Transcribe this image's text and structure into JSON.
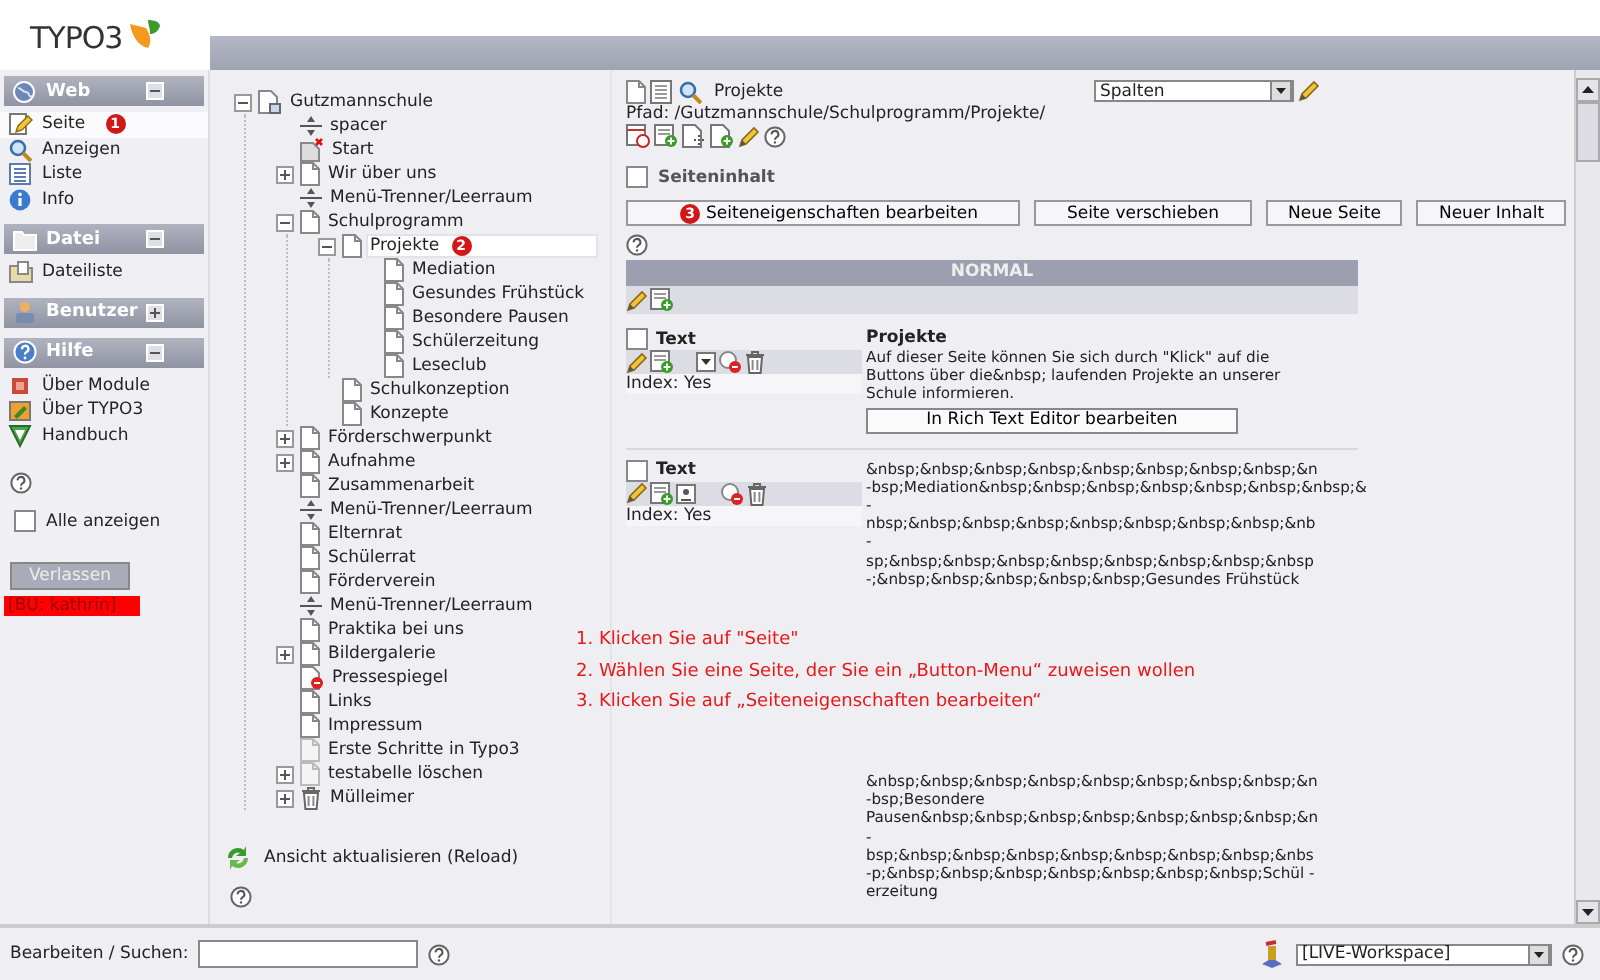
{
  "logo": "TYPO3",
  "modules": [
    {
      "title": "Web",
      "expanded": true,
      "items": [
        {
          "label": "Seite",
          "selected": true,
          "badge": "1"
        },
        {
          "label": "Anzeigen",
          "selected": false
        },
        {
          "label": "Liste",
          "selected": false
        },
        {
          "label": "Info",
          "selected": false
        }
      ]
    },
    {
      "title": "Datei",
      "expanded": true,
      "items": [
        {
          "label": "Dateiliste",
          "selected": false
        }
      ]
    },
    {
      "title": "Benutzer",
      "expanded": false
    },
    {
      "title": "Hilfe",
      "expanded": true,
      "items": [
        {
          "label": "Über Module",
          "selected": false
        },
        {
          "label": "Über TYPO3",
          "selected": false
        },
        {
          "label": "Handbuch",
          "selected": false
        }
      ]
    }
  ],
  "show_all": {
    "label": "Alle anzeigen",
    "checked": false
  },
  "logout": "Verlassen",
  "user": "[BU: kathrin]",
  "tree": [
    {
      "label": "Gutzmannschule",
      "kind": "root",
      "selected": false,
      "expanded": true,
      "children": [
        {
          "label": "spacer",
          "kind": "separator",
          "selected": false
        },
        {
          "label": "Start",
          "kind": "hidden",
          "selected": false
        },
        {
          "label": "Wir über uns",
          "kind": "page",
          "selected": false,
          "expanded": false
        },
        {
          "label": "Menü-Trenner/Leerraum",
          "kind": "separator",
          "selected": false
        },
        {
          "label": "Schulprogramm",
          "kind": "page",
          "selected": false,
          "expanded": true,
          "children": [
            {
              "label": "Projekte",
              "kind": "page",
              "selected": true,
              "badge": "2",
              "expanded": true,
              "children": [
                {
                  "label": "Mediation",
                  "kind": "page",
                  "selected": false
                },
                {
                  "label": "Gesundes Frühstück",
                  "kind": "page",
                  "selected": false
                },
                {
                  "label": "Besondere Pausen",
                  "kind": "page",
                  "selected": false
                },
                {
                  "label": "Schülerzeitung",
                  "kind": "page",
                  "selected": false
                },
                {
                  "label": "Leseclub",
                  "kind": "page",
                  "selected": false
                }
              ]
            },
            {
              "label": "Schulkonzeption",
              "kind": "page",
              "selected": false
            },
            {
              "label": "Konzepte",
              "kind": "page",
              "selected": false
            }
          ]
        },
        {
          "label": "Förderschwerpunkt",
          "kind": "page",
          "selected": false,
          "expanded": false
        },
        {
          "label": "Aufnahme",
          "kind": "page",
          "selected": false,
          "expanded": false
        },
        {
          "label": "Zusammenarbeit",
          "kind": "page",
          "selected": false
        },
        {
          "label": "Menü-Trenner/Leerraum",
          "kind": "separator",
          "selected": false
        },
        {
          "label": "Elternrat",
          "kind": "page",
          "selected": false
        },
        {
          "label": "Schülerrat",
          "kind": "page",
          "selected": false
        },
        {
          "label": "Förderverein",
          "kind": "page",
          "selected": false
        },
        {
          "label": "Menü-Trenner/Leerraum",
          "kind": "separator",
          "selected": false
        },
        {
          "label": "Praktika bei uns",
          "kind": "page",
          "selected": false
        },
        {
          "label": "Bildergalerie",
          "kind": "page",
          "selected": false,
          "expanded": false
        },
        {
          "label": "Pressespiegel",
          "kind": "disabled",
          "selected": false
        },
        {
          "label": "Links",
          "kind": "page",
          "selected": false
        },
        {
          "label": "Impressum",
          "kind": "page",
          "selected": false
        },
        {
          "label": "Erste Schritte in Typo3",
          "kind": "faint",
          "selected": false
        },
        {
          "label": "testabelle löschen",
          "kind": "faint",
          "selected": false,
          "expanded": false
        },
        {
          "label": "Mülleimer",
          "kind": "trash",
          "selected": false,
          "expanded": false
        }
      ]
    }
  ],
  "reload": "Ansicht aktualisieren (Reload)",
  "content": {
    "page_title": "Projekte",
    "path": "Pfad: /Gutzmannschule/Schulprogramm/Projekte/",
    "view_select": "Spalten",
    "section": {
      "label": "Seiteninhalt",
      "checked": false
    },
    "buttons": [
      {
        "label": "Seiteneigenschaften bearbeiten",
        "badge": "3"
      },
      {
        "label": "Seite verschieben"
      },
      {
        "label": "Neue Seite"
      },
      {
        "label": "Neuer Inhalt"
      }
    ],
    "column_title": "NORMAL",
    "elements": [
      {
        "kind": "record",
        "type": "Text",
        "checked": false,
        "index": "Index: Yes",
        "heading": "Projekte",
        "lines": [
          "Auf dieser Seite können Sie sich durch \"Klick\" auf die",
          "Buttons über die&nbsp; laufenden Projekte an unserer",
          "Schule informieren."
        ],
        "button": "In Rich Text Editor bearbeiten"
      },
      {
        "kind": "record",
        "type": "Text",
        "checked": false,
        "index": "Index: Yes",
        "lines": [
          "&nbsp;&nbsp;&nbsp;&nbsp;&nbsp;&nbsp;&nbsp;&nbsp;&n",
          "-bsp;Mediation&nbsp;&nbsp;&nbsp;&nbsp;&nbsp;&nbsp;&nbsp;&",
          "-",
          "nbsp;&nbsp;&nbsp;&nbsp;&nbsp;&nbsp;&nbsp;&nbsp;&nb",
          "-",
          "sp;&nbsp;&nbsp;&nbsp;&nbsp;&nbsp;&nbsp;&nbsp;&nbsp",
          "-;&nbsp;&nbsp;&nbsp;&nbsp;&nbsp;Gesundes Frühstück"
        ]
      },
      {
        "kind": "text-only",
        "lines": [
          "&nbsp;&nbsp;&nbsp;&nbsp;&nbsp;&nbsp;&nbsp;&nbsp;&n",
          "-bsp;Besondere",
          "Pausen&nbsp;&nbsp;&nbsp;&nbsp;&nbsp;&nbsp;&nbsp;&n",
          "-",
          "bsp;&nbsp;&nbsp;&nbsp;&nbsp;&nbsp;&nbsp;&nbsp;&nbs",
          "-p;&nbsp;&nbsp;&nbsp;&nbsp;&nbsp;&nbsp;&nbsp;Schül -",
          "erzeitung"
        ]
      }
    ]
  },
  "instructions": [
    "1. Klicken Sie auf \"Seite\"",
    "2. Wählen Sie eine Seite, der Sie ein „Button-Menu“ zuweisen wollen",
    "3. Klicken Sie auf „Seiteneigenschaften bearbeiten“"
  ],
  "search": {
    "label": "Bearbeiten / Suchen:"
  },
  "workspace": "[LIVE-Workspace]"
}
